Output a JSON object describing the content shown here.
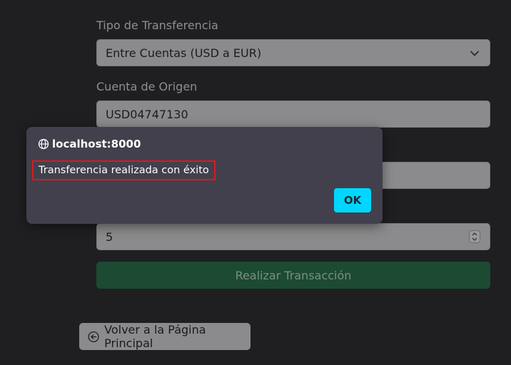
{
  "form": {
    "transfer_type": {
      "label": "Tipo de Transferencia",
      "value": "Entre Cuentas (USD a EUR)"
    },
    "source_account": {
      "label": "Cuenta de Origen",
      "value": "USD04747130"
    },
    "hidden_field": {
      "value": ""
    },
    "amount": {
      "value": "5"
    },
    "submit_label": "Realizar Transacción"
  },
  "back_button": {
    "label": "Volver a la Página Principal"
  },
  "dialog": {
    "origin": "localhost:8000",
    "message": "Transferencia realizada con éxito",
    "ok_label": "OK"
  },
  "colors": {
    "accent_ok": "#00d7ff",
    "submit_green": "#1c4a33",
    "highlight_border": "#e0161e"
  }
}
